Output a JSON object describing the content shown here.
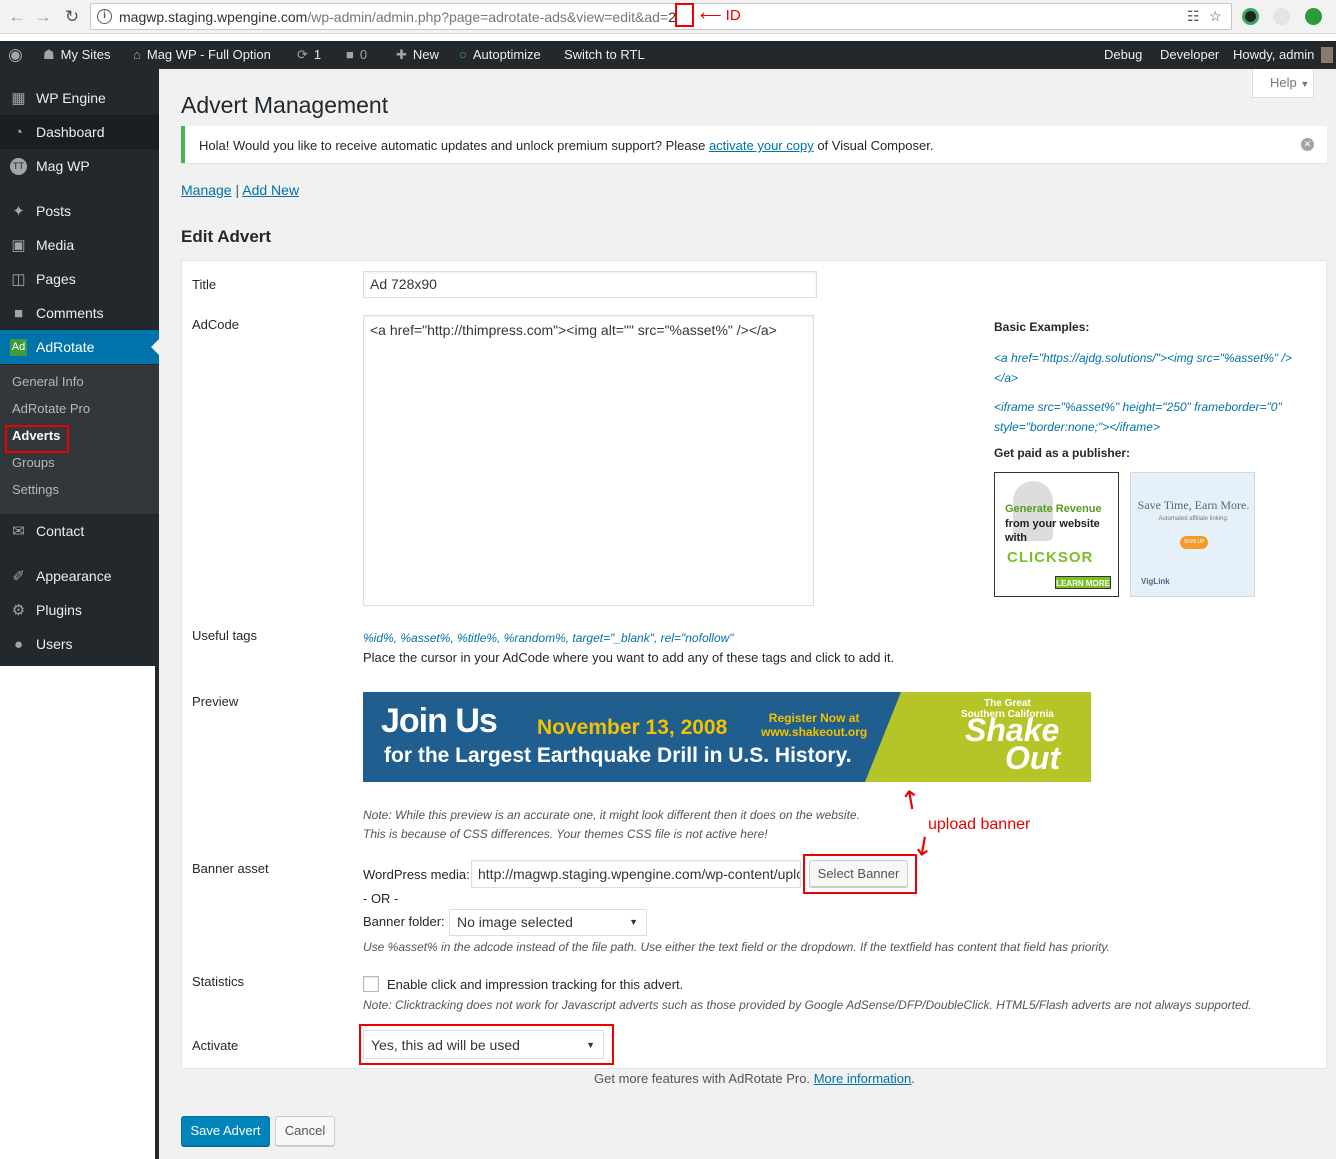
{
  "browser": {
    "url_host": "magwp.staging.wpengine.com",
    "url_path": "/wp-admin/admin.php?page=adrotate-ads&view=edit&ad=",
    "url_id": "2",
    "annotation_id": "ID"
  },
  "adminbar": {
    "my_sites": "My Sites",
    "site_name": "Mag WP - Full Option",
    "updates_count": "1",
    "comments_count": "0",
    "new_label": "New",
    "autoptimize": "Autoptimize",
    "switch_rtl": "Switch to RTL",
    "debug": "Debug",
    "developer": "Developer",
    "howdy": "Howdy, admin"
  },
  "sidebar": {
    "items": [
      {
        "label": "WP Engine",
        "icon": "grid-icon"
      },
      {
        "label": "Dashboard",
        "icon": "dashboard-icon"
      },
      {
        "label": "Mag WP",
        "icon": "magwp-icon"
      },
      {
        "label": "Posts",
        "icon": "pin-icon"
      },
      {
        "label": "Media",
        "icon": "media-icon"
      },
      {
        "label": "Pages",
        "icon": "page-icon"
      },
      {
        "label": "Comments",
        "icon": "comment-icon"
      },
      {
        "label": "AdRotate",
        "icon": "adrotate-icon"
      },
      {
        "label": "Contact",
        "icon": "mail-icon"
      },
      {
        "label": "Appearance",
        "icon": "brush-icon"
      },
      {
        "label": "Plugins",
        "icon": "plug-icon"
      },
      {
        "label": "Users",
        "icon": "user-icon"
      }
    ],
    "submenu": [
      "General Info",
      "AdRotate Pro",
      "Adverts",
      "Groups",
      "Settings"
    ]
  },
  "page": {
    "title": "Advert Management",
    "help": "Help",
    "notice_before": "Hola! Would you like to receive automatic updates and unlock premium support? Please ",
    "notice_link": "activate your copy",
    "notice_after": " of Visual Composer.",
    "manage": "Manage",
    "separator": "|",
    "add_new": "Add New",
    "section_title": "Edit Advert"
  },
  "form": {
    "title_label": "Title",
    "title_value": "Ad 728x90",
    "adcode_label": "AdCode",
    "adcode_value": "<a href=\"http://thimpress.com\"><img alt=\"\" src=\"%asset%\" /></a>",
    "basic_examples": "Basic Examples:",
    "example1": "<a href=\"https://ajdg.solutions/\"><img src=\"%asset%\" /></a>",
    "example2": "<iframe src=\"%asset%\" height=\"250\" frameborder=\"0\" style=\"border:none;\"></iframe>",
    "get_paid": "Get paid as a publisher:",
    "ad1": {
      "line1": "Generate Revenue",
      "line2": "from your website",
      "line3": "with",
      "brand": "CLICKSOR",
      "cta": "LEARN MORE"
    },
    "ad2": {
      "title": "Save Time, Earn More.",
      "sub": "Automated affiliate linking.",
      "cta": "SIGN UP",
      "brand": "VigLink"
    },
    "useful_tags_label": "Useful tags",
    "useful_tags": "%id%, %asset%, %title%, %random%, target=\"_blank\", rel=\"nofollow\"",
    "useful_tags_help": "Place the cursor in your AdCode where you want to add any of these tags and click to add it.",
    "preview_label": "Preview",
    "banner": {
      "join_us": "Join Us",
      "date": "November 13, 2008",
      "register": "Register Now at",
      "register_url": "www.shakeout.org",
      "subtitle": "for the Largest Earthquake Drill in U.S. History.",
      "great1": "The Great",
      "great2": "Southern California",
      "shake": "Shake",
      "out": "Out"
    },
    "preview_note1": "Note: While this preview is an accurate one, it might look different then it does on the website.",
    "preview_note2": "This is because of CSS differences. Your themes CSS file is not active here!",
    "upload_annotation": "upload banner",
    "banner_asset_label": "Banner asset",
    "wp_media_label": "WordPress media:",
    "wp_media_value": "http://magwp.staging.wpengine.com/wp-content/uploads",
    "select_banner": "Select Banner",
    "or": "- OR -",
    "banner_folder_label": "Banner folder:",
    "banner_folder_value": "No image selected",
    "asset_help": "Use %asset% in the adcode instead of the file path. Use either the text field or the dropdown. If the textfield has content that field has priority.",
    "statistics_label": "Statistics",
    "tracking_label": "Enable click and impression tracking for this advert.",
    "tracking_note": "Note: Clicktracking does not work for Javascript adverts such as those provided by Google AdSense/DFP/DoubleClick. HTML5/Flash adverts are not always supported.",
    "activate_label": "Activate",
    "activate_value": "Yes, this ad will be used"
  },
  "footer": {
    "more_features": "Get more features with AdRotate Pro.",
    "more_info": "More information",
    "period": ".",
    "save": "Save Advert",
    "cancel": "Cancel"
  },
  "colors": {
    "wp_blue": "#0073aa",
    "admin_dark": "#23282d",
    "annotation_red": "#ee0000",
    "notice_green": "#46b450"
  }
}
